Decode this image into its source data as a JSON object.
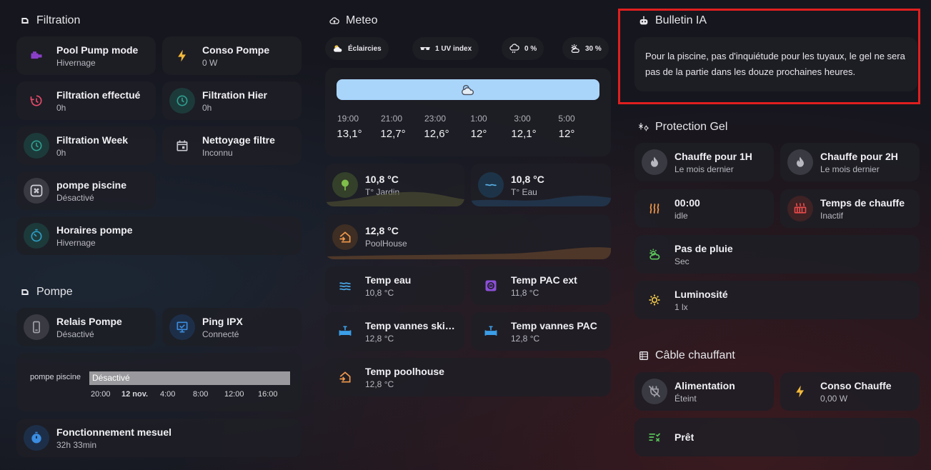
{
  "filtration": {
    "title": "Filtration",
    "tiles": [
      {
        "title": "Pool Pump mode",
        "sub": "Hivernage"
      },
      {
        "title": "Conso Pompe",
        "sub": "0 W"
      },
      {
        "title": "Filtration effectué",
        "sub": "0h"
      },
      {
        "title": "Filtration Hier",
        "sub": "0h"
      },
      {
        "title": "Filtration Week",
        "sub": "0h"
      },
      {
        "title": "Nettoyage filtre",
        "sub": "Inconnu"
      },
      {
        "title": "pompe piscine",
        "sub": "Désactivé"
      },
      {
        "title": "Horaires pompe",
        "sub": "Hivernage"
      }
    ]
  },
  "pompe": {
    "title": "Pompe",
    "tiles": [
      {
        "title": "Relais Pompe",
        "sub": "Désactivé"
      },
      {
        "title": "Ping IPX",
        "sub": "Connecté"
      }
    ],
    "timeline": {
      "label": "pompe piscine",
      "state": "Désactivé",
      "ticks": [
        "20:00",
        "12 nov.",
        "4:00",
        "8:00",
        "12:00",
        "16:00"
      ]
    },
    "runtime": {
      "title": "Fonctionnement mesuel",
      "sub": "32h 33min"
    }
  },
  "meteo": {
    "title": "Meteo",
    "pills": [
      {
        "icon": "partly-cloudy-icon",
        "label": "Éclaircies"
      },
      {
        "icon": "sunglasses-icon",
        "label": "1 UV index"
      },
      {
        "icon": "cloud-rain-icon",
        "label": "0 %"
      },
      {
        "icon": "sun-cloud-icon",
        "label": "30 %"
      }
    ],
    "forecast": {
      "hours": [
        "19:00",
        "21:00",
        "23:00",
        "1:00",
        "3:00",
        "5:00"
      ],
      "temps": [
        "13,1°",
        "12,7°",
        "12,6°",
        "12°",
        "12,1°",
        "12°"
      ]
    },
    "sensors": [
      {
        "value": "10,8 °C",
        "label": "T° Jardin"
      },
      {
        "value": "10,8 °C",
        "label": "T° Eau"
      },
      {
        "value": "12,8 °C",
        "label": "PoolHouse"
      }
    ],
    "tiles": [
      {
        "title": "Temp eau",
        "sub": "10,8 °C"
      },
      {
        "title": "Temp PAC ext",
        "sub": "11,8 °C"
      },
      {
        "title": "Temp vannes skimmer",
        "sub": "12,8 °C"
      },
      {
        "title": "Temp vannes PAC",
        "sub": "12,8 °C"
      },
      {
        "title": "Temp poolhouse",
        "sub": "12,8 °C"
      }
    ]
  },
  "bulletin": {
    "title": "Bulletin IA",
    "text": "Pour la piscine, pas d'inquiétude pour les tuyaux, le gel ne sera pas de la partie dans les douze prochaines heures."
  },
  "protection": {
    "title": "Protection Gel",
    "tiles": [
      {
        "title": "Chauffe pour 1H",
        "sub": "Le mois dernier"
      },
      {
        "title": "Chauffe pour 2H",
        "sub": "Le mois dernier"
      },
      {
        "title": "00:00",
        "sub": "idle"
      },
      {
        "title": "Temps de chauffe",
        "sub": "Inactif"
      },
      {
        "title": "Pas de pluie",
        "sub": "Sec"
      },
      {
        "title": "Luminosité",
        "sub": "1 lx"
      }
    ]
  },
  "cable": {
    "title": "Câble chauffant",
    "tiles": [
      {
        "title": "Alimentation",
        "sub": "Éteint"
      },
      {
        "title": "Conso Chauffe",
        "sub": "0,00 W"
      },
      {
        "title": "Prêt",
        "sub": ""
      }
    ]
  },
  "colors": {
    "accent_blue": "#3b8de0",
    "accent_teal": "#2e9e8f",
    "accent_orange": "#f2994a",
    "accent_red": "#e84a4a",
    "highlight": "#e01f1f"
  }
}
